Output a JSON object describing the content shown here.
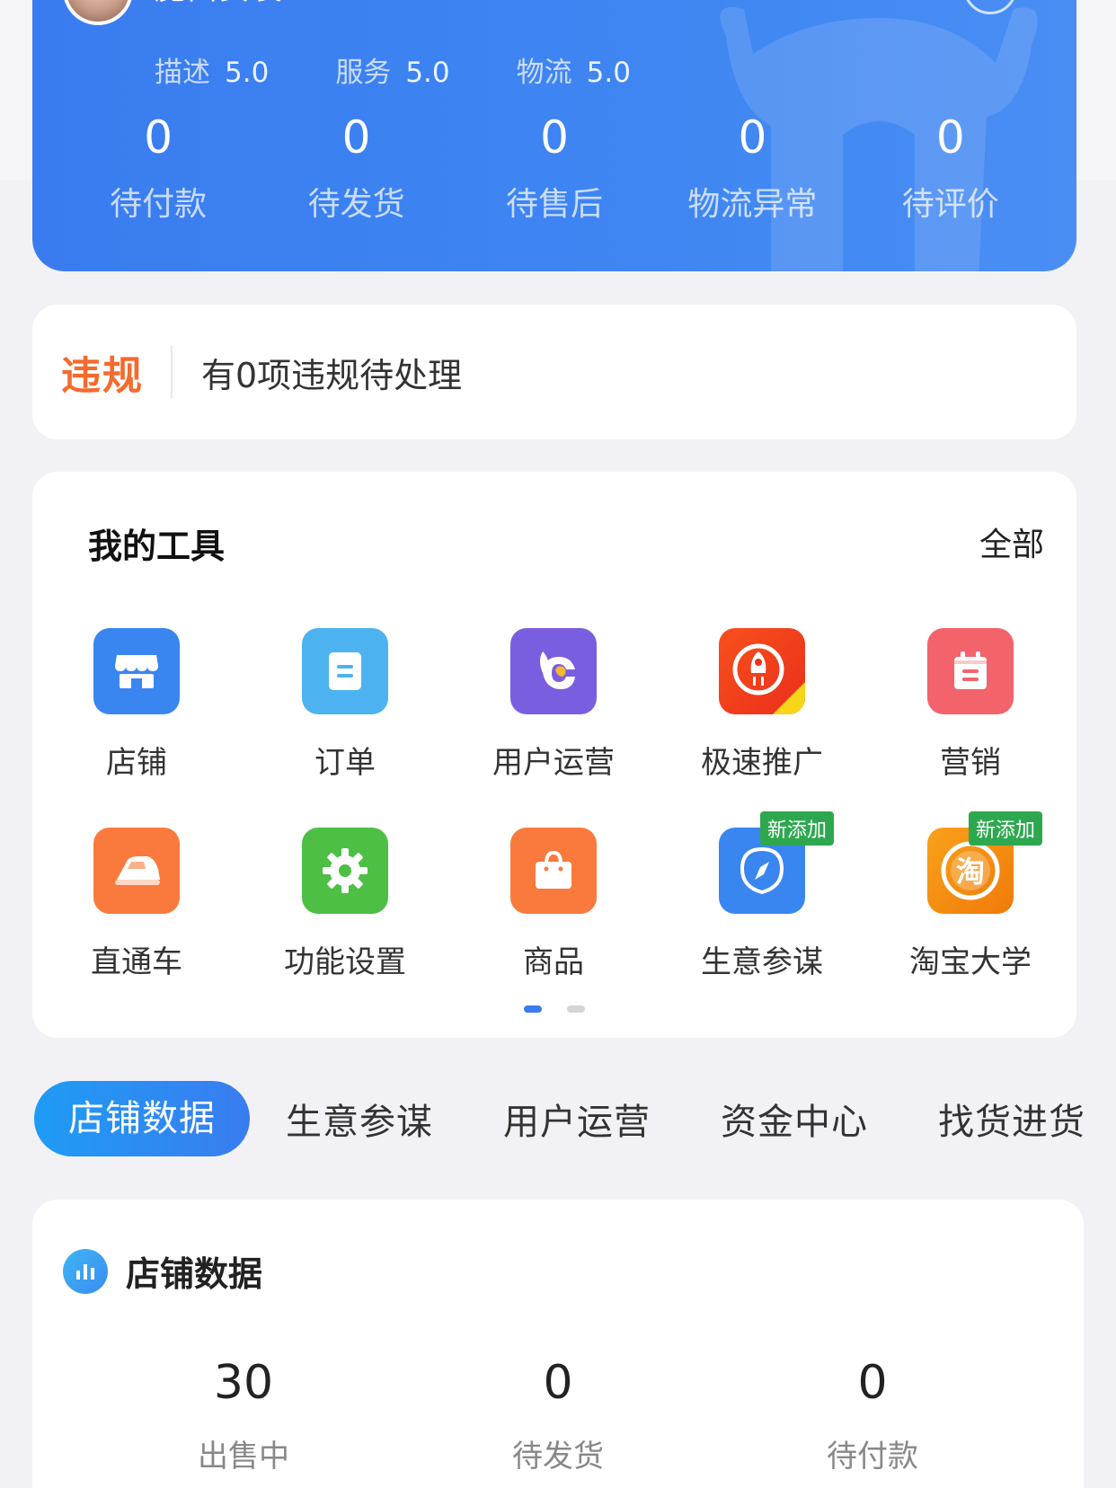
{
  "shop": {
    "name": "魔西女装",
    "ratings": [
      {
        "label": "描述",
        "value": "5.0"
      },
      {
        "label": "服务",
        "value": "5.0"
      },
      {
        "label": "物流",
        "value": "5.0"
      }
    ],
    "stats": [
      {
        "value": "0",
        "label": "待付款"
      },
      {
        "value": "0",
        "label": "待发货"
      },
      {
        "value": "0",
        "label": "待售后"
      },
      {
        "value": "0",
        "label": "物流异常"
      },
      {
        "value": "0",
        "label": "待评价"
      }
    ]
  },
  "violation": {
    "tag": "违规",
    "text": "有0项违规待处理"
  },
  "tools": {
    "title": "我的工具",
    "all_label": "全部",
    "items": [
      {
        "label": "店铺",
        "icon": "store-icon",
        "color": "#3a86f0"
      },
      {
        "label": "订单",
        "icon": "order-icon",
        "color": "#4db3f0"
      },
      {
        "label": "用户运营",
        "icon": "user-ops-icon",
        "color": "#7a5ee0"
      },
      {
        "label": "极速推广",
        "icon": "rocket-icon",
        "color": "#f04a1e"
      },
      {
        "label": "营销",
        "icon": "calendar-icon",
        "color": "#f2636b"
      },
      {
        "label": "直通车",
        "icon": "train-icon",
        "color": "#f97a3c"
      },
      {
        "label": "功能设置",
        "icon": "gear-icon",
        "color": "#4cbf44"
      },
      {
        "label": "商品",
        "icon": "bag-icon",
        "color": "#f97a3c"
      },
      {
        "label": "生意参谋",
        "icon": "compass-icon",
        "color": "#3a86f0",
        "badge": "新添加"
      },
      {
        "label": "淘宝大学",
        "icon": "taobao-icon",
        "color": "#f58a0a",
        "badge": "新添加"
      }
    ],
    "page": 1,
    "page_count": 2
  },
  "tabs": [
    "店铺数据",
    "生意参谋",
    "用户运营",
    "资金中心",
    "找货进货"
  ],
  "store_data": {
    "title": "店铺数据",
    "stats": [
      {
        "value": "30",
        "label": "出售中"
      },
      {
        "value": "0",
        "label": "待发货"
      },
      {
        "value": "0",
        "label": "待付款"
      }
    ]
  }
}
